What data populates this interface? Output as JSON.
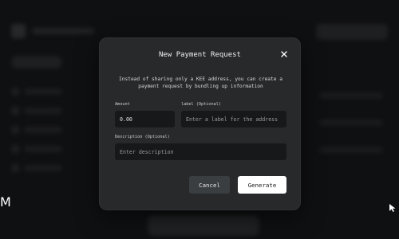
{
  "brand": {
    "mark": "M"
  },
  "modal": {
    "title": "New Payment Request",
    "description": "Instead of sharing only a KEE address, you can create a payment request by bundling up information",
    "fields": {
      "amount": {
        "label": "Amount",
        "value": "0.00",
        "placeholder": ""
      },
      "label": {
        "label": "label (Optional)",
        "value": "",
        "placeholder": "Enter a label for the address"
      },
      "description": {
        "label": "Description (Optional)",
        "value": "",
        "placeholder": "Enter description"
      }
    },
    "buttons": {
      "cancel": "Cancel",
      "generate": "Generate"
    },
    "icons": {
      "close": "close-icon"
    }
  },
  "colors": {
    "background": "#0f1011",
    "modal": "#27292b",
    "input": "#17181a",
    "cancel_button": "#3b3e41",
    "generate_button": "#ffffff"
  }
}
